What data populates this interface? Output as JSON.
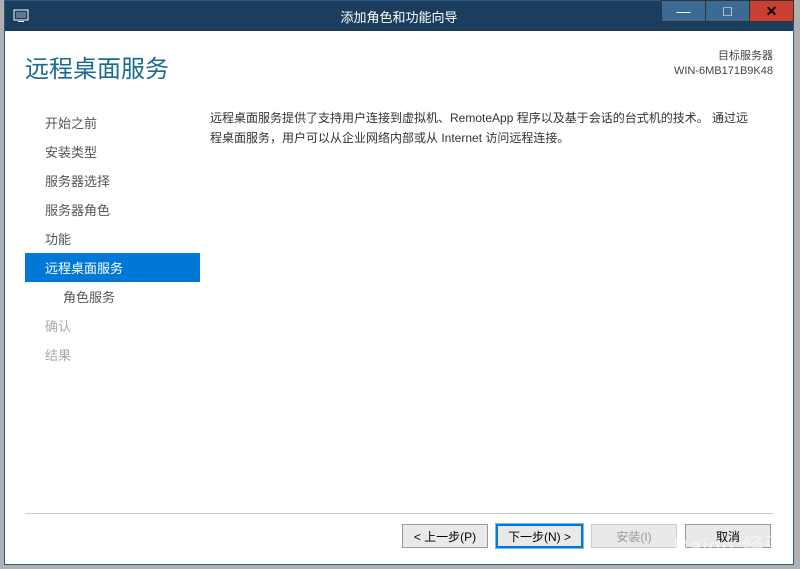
{
  "titlebar": {
    "title": "添加角色和功能向导"
  },
  "header": {
    "page_title": "远程桌面服务",
    "target_label": "目标服务器",
    "target_name": "WIN-6MB171B9K48"
  },
  "sidebar": {
    "items": [
      {
        "label": "开始之前",
        "state": "normal"
      },
      {
        "label": "安装类型",
        "state": "normal"
      },
      {
        "label": "服务器选择",
        "state": "normal"
      },
      {
        "label": "服务器角色",
        "state": "normal"
      },
      {
        "label": "功能",
        "state": "normal"
      },
      {
        "label": "远程桌面服务",
        "state": "selected"
      },
      {
        "label": "角色服务",
        "state": "normal",
        "indent": true
      },
      {
        "label": "确认",
        "state": "disabled"
      },
      {
        "label": "结果",
        "state": "disabled"
      }
    ]
  },
  "description": {
    "text": "远程桌面服务提供了支持用户连接到虚拟机、RemoteApp 程序以及基于会话的台式机的技术。 通过远程桌面服务，用户可以从企业网络内部或从 Internet 访问远程连接。"
  },
  "buttons": {
    "prev": "< 上一步(P)",
    "next": "下一步(N) >",
    "install": "安装(I)",
    "cancel": "取消"
  },
  "watermark": "Baidu 经验"
}
